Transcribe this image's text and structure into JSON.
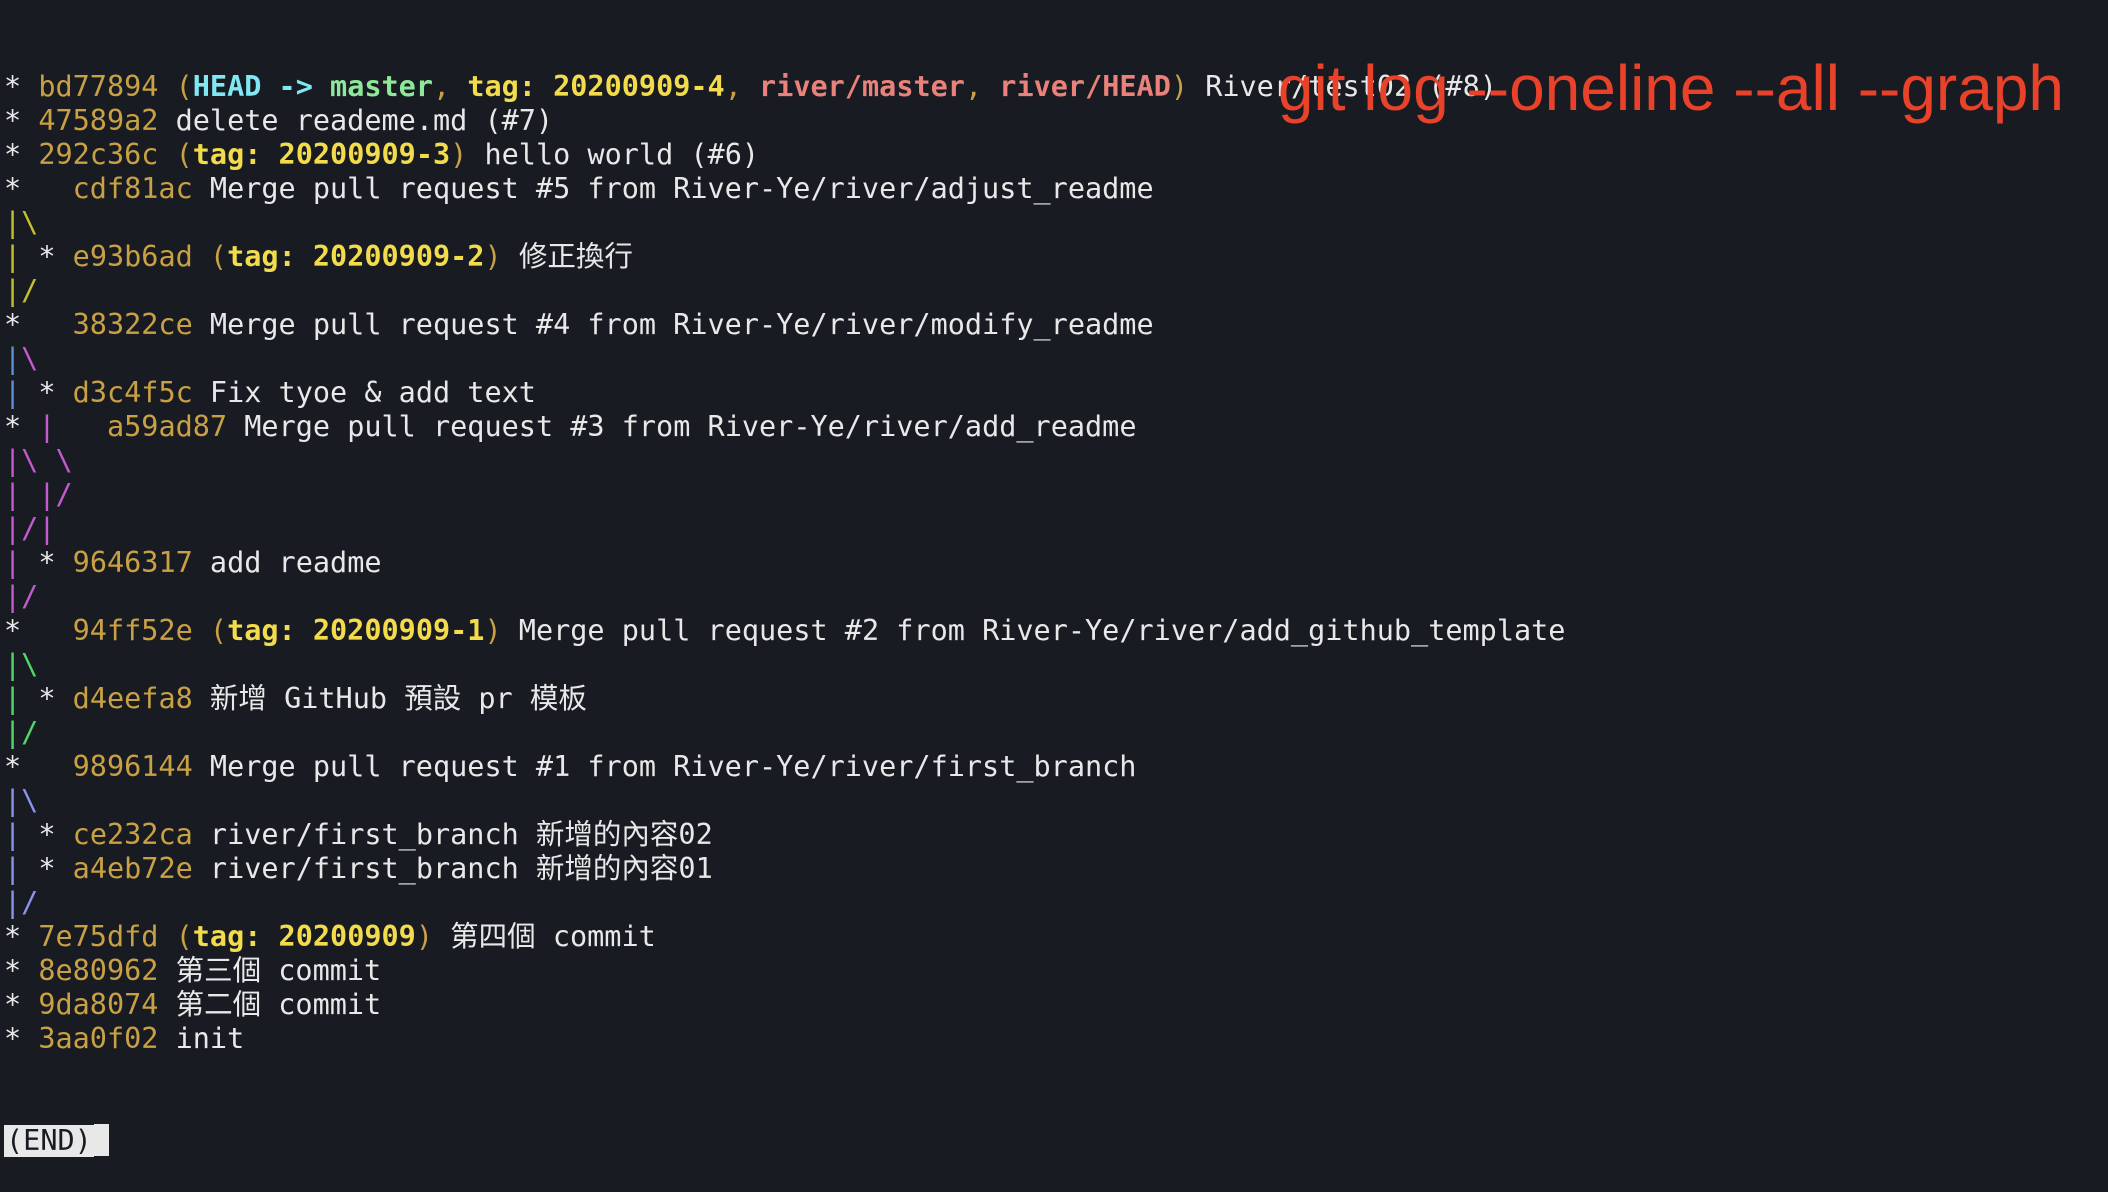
{
  "palette": {
    "default": "#e8e8e8",
    "hash": "#c9a144",
    "paren": "#c9a144",
    "head": "#7fe8f3",
    "branch": "#8fe89a",
    "tag": "#f2dc4b",
    "remote": "#e8827a",
    "graph_yellow": "#c6c02b",
    "graph_blue": "#5b8fd6",
    "graph_magenta": "#c45ad0",
    "graph_green": "#4fd86a",
    "graph_periwinkle": "#8a94ec",
    "annotation": "#e8422a",
    "end_bg": "#e8e8e8",
    "end_fg": "#181b22",
    "background": "#181b22"
  },
  "annotation": {
    "text": "git log --oneline --all --graph"
  },
  "log_lines": [
    {
      "segments": [
        [
          "* ",
          "default"
        ],
        [
          "bd77894",
          "hash"
        ],
        [
          " (",
          "paren"
        ],
        [
          "HEAD -> ",
          "head"
        ],
        [
          "master",
          "branch"
        ],
        [
          ", ",
          "paren"
        ],
        [
          "tag: 20200909-4",
          "tag"
        ],
        [
          ", ",
          "paren"
        ],
        [
          "river/master",
          "remote"
        ],
        [
          ", ",
          "paren"
        ],
        [
          "river/HEAD",
          "remote"
        ],
        [
          ")",
          "paren"
        ],
        [
          " River/test02 (#8)",
          "default"
        ]
      ]
    },
    {
      "segments": [
        [
          "* ",
          "default"
        ],
        [
          "47589a2",
          "hash"
        ],
        [
          " delete reademe.md (#7)",
          "default"
        ]
      ]
    },
    {
      "segments": [
        [
          "* ",
          "default"
        ],
        [
          "292c36c",
          "hash"
        ],
        [
          " (",
          "paren"
        ],
        [
          "tag: 20200909-3",
          "tag"
        ],
        [
          ")",
          "paren"
        ],
        [
          " hello world (#6)",
          "default"
        ]
      ]
    },
    {
      "segments": [
        [
          "*   ",
          "default"
        ],
        [
          "cdf81ac",
          "hash"
        ],
        [
          " Merge pull request #5 from River-Ye/river/adjust_readme",
          "default"
        ]
      ]
    },
    {
      "segments": [
        [
          "|\\",
          "graph_yellow"
        ]
      ]
    },
    {
      "segments": [
        [
          "|",
          "graph_yellow"
        ],
        [
          " * ",
          "default"
        ],
        [
          "e93b6ad",
          "hash"
        ],
        [
          " (",
          "paren"
        ],
        [
          "tag: 20200909-2",
          "tag"
        ],
        [
          ")",
          "paren"
        ],
        [
          " 修正換行",
          "default"
        ]
      ]
    },
    {
      "segments": [
        [
          "|/",
          "graph_yellow"
        ]
      ]
    },
    {
      "segments": [
        [
          "*   ",
          "default"
        ],
        [
          "38322ce",
          "hash"
        ],
        [
          " Merge pull request #4 from River-Ye/river/modify_readme",
          "default"
        ]
      ]
    },
    {
      "segments": [
        [
          "|",
          "graph_blue"
        ],
        [
          "\\",
          "graph_magenta"
        ]
      ]
    },
    {
      "segments": [
        [
          "|",
          "graph_blue"
        ],
        [
          " * ",
          "default"
        ],
        [
          "d3c4f5c",
          "hash"
        ],
        [
          " Fix tyoe & add text",
          "default"
        ]
      ]
    },
    {
      "segments": [
        [
          "* ",
          "default"
        ],
        [
          "|",
          "graph_magenta"
        ],
        [
          "   ",
          "default"
        ],
        [
          "a59ad87",
          "hash"
        ],
        [
          " Merge pull request #3 from River-Ye/river/add_readme",
          "default"
        ]
      ]
    },
    {
      "segments": [
        [
          "|\\ \\",
          "graph_magenta"
        ]
      ]
    },
    {
      "segments": [
        [
          "| |/",
          "graph_magenta"
        ]
      ]
    },
    {
      "segments": [
        [
          "|/|",
          "graph_magenta"
        ]
      ]
    },
    {
      "segments": [
        [
          "|",
          "graph_magenta"
        ],
        [
          " * ",
          "default"
        ],
        [
          "9646317",
          "hash"
        ],
        [
          " add readme",
          "default"
        ]
      ]
    },
    {
      "segments": [
        [
          "|/",
          "graph_magenta"
        ]
      ]
    },
    {
      "segments": [
        [
          "*   ",
          "default"
        ],
        [
          "94ff52e",
          "hash"
        ],
        [
          " (",
          "paren"
        ],
        [
          "tag: 20200909-1",
          "tag"
        ],
        [
          ")",
          "paren"
        ],
        [
          " Merge pull request #2 from River-Ye/river/add_github_template",
          "default"
        ]
      ]
    },
    {
      "segments": [
        [
          "|\\",
          "graph_green"
        ]
      ]
    },
    {
      "segments": [
        [
          "|",
          "graph_green"
        ],
        [
          " * ",
          "default"
        ],
        [
          "d4eefa8",
          "hash"
        ],
        [
          " 新增 GitHub 預設 pr 模板",
          "default"
        ]
      ]
    },
    {
      "segments": [
        [
          "|/",
          "graph_green"
        ]
      ]
    },
    {
      "segments": [
        [
          "*   ",
          "default"
        ],
        [
          "9896144",
          "hash"
        ],
        [
          " Merge pull request #1 from River-Ye/river/first_branch",
          "default"
        ]
      ]
    },
    {
      "segments": [
        [
          "|\\",
          "graph_periwinkle"
        ]
      ]
    },
    {
      "segments": [
        [
          "|",
          "graph_periwinkle"
        ],
        [
          " * ",
          "default"
        ],
        [
          "ce232ca",
          "hash"
        ],
        [
          " river/first_branch 新增的內容02",
          "default"
        ]
      ]
    },
    {
      "segments": [
        [
          "|",
          "graph_periwinkle"
        ],
        [
          " * ",
          "default"
        ],
        [
          "a4eb72e",
          "hash"
        ],
        [
          " river/first_branch 新增的內容01",
          "default"
        ]
      ]
    },
    {
      "segments": [
        [
          "|/",
          "graph_periwinkle"
        ]
      ]
    },
    {
      "segments": [
        [
          "* ",
          "default"
        ],
        [
          "7e75dfd",
          "hash"
        ],
        [
          " (",
          "paren"
        ],
        [
          "tag: 20200909",
          "tag"
        ],
        [
          ")",
          "paren"
        ],
        [
          " 第四個 commit",
          "default"
        ]
      ]
    },
    {
      "segments": [
        [
          "* ",
          "default"
        ],
        [
          "8e80962",
          "hash"
        ],
        [
          " 第三個 commit",
          "default"
        ]
      ]
    },
    {
      "segments": [
        [
          "* ",
          "default"
        ],
        [
          "9da8074",
          "hash"
        ],
        [
          " 第二個 commit",
          "default"
        ]
      ]
    },
    {
      "segments": [
        [
          "* ",
          "default"
        ],
        [
          "3aa0f02",
          "hash"
        ],
        [
          " init",
          "default"
        ]
      ]
    }
  ],
  "pager": {
    "end_label": "(END)"
  }
}
